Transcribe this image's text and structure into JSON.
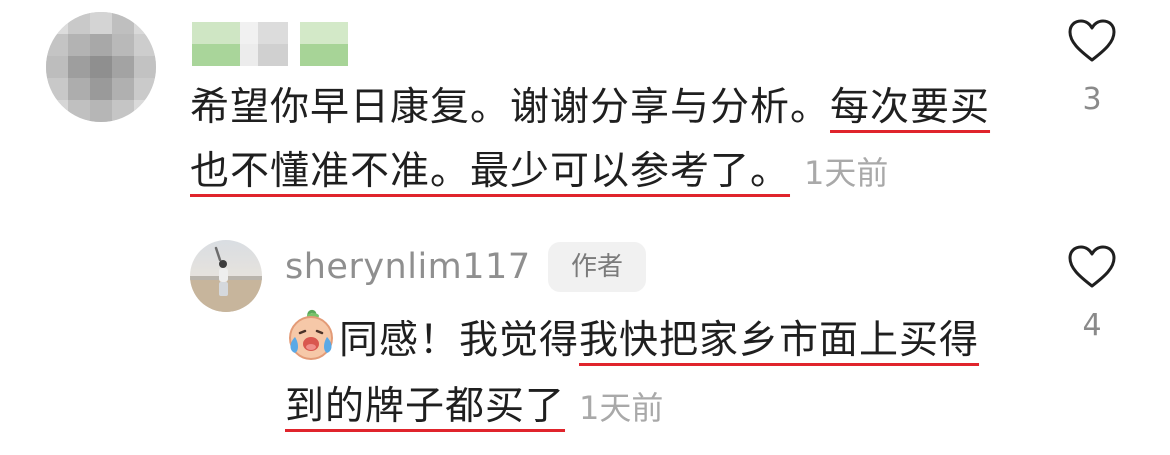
{
  "comment": {
    "text_plain": "希望你早日康复。谢谢分享与分析。",
    "text_underlined": "每次要买也不懂准不准。最少可以参考了。",
    "time": "1天前",
    "like_count": "3"
  },
  "reply": {
    "username": "sherynlim117",
    "badge": "作者",
    "text_plain": "同感！我觉得",
    "text_underlined": "我快把家乡市面上买得到的牌子都买了",
    "time": "1天前",
    "like_count": "4",
    "emoji": "crying-face-emoji"
  },
  "colors": {
    "underline": "#e0242c",
    "muted_text": "#a9a9a9",
    "badge_bg": "#f1f1f1"
  }
}
